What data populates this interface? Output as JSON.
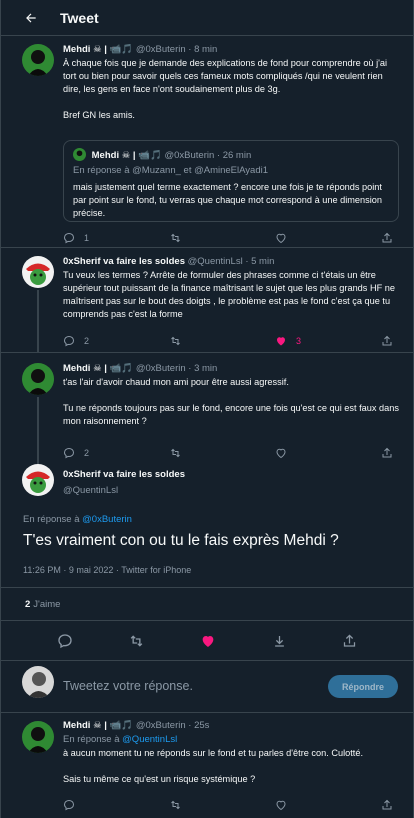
{
  "header": {
    "title": "Tweet"
  },
  "tweets": [
    {
      "name": "Mehdi ☠ | 📹🎵",
      "handle": "@0xButerin",
      "time": "· 8 min",
      "text": [
        "À chaque fois que je demande des explications de fond pour comprendre où j'ai tort ou bien pour savoir quels ces fameux mots compliqués /qui ne veulent rien dire, les gens en face n'ont soudainement plus de 3g.",
        "Bref GN les amis."
      ],
      "actions": {
        "reply": "1",
        "retweet": "",
        "like": "",
        "share": ""
      }
    },
    {
      "quote": {
        "name": "Mehdi ☠ | 📹🎵",
        "handle": "@0xButerin",
        "time": "· 26 min",
        "in_reply_prefix": "En réponse à",
        "in_reply_1": "@Muzann_",
        "in_reply_sep": "et",
        "in_reply_2": "@AmineElAyadi1",
        "text": "mais justement quel terme exactement ? encore une fois je te réponds point par point sur le fond, tu verras que chaque mot correspond à une dimension précise."
      }
    },
    {
      "name": "0xSherif va faire les soldes",
      "handle": "@QuentinLsl",
      "time": "· 5 min",
      "text": [
        "Tu veux les termes ? Arrête de formuler des phrases comme ci t'étais un être supérieur tout puissant de la finance maîtrisant le sujet que les plus grands HF ne maîtrisent pas sur le bout des doigts , le problème est pas le fond c'est ça que tu comprends pas c'est la forme"
      ],
      "actions": {
        "reply": "2",
        "retweet": "",
        "like": "3",
        "share": ""
      }
    },
    {
      "name": "Mehdi ☠ | 📹🎵",
      "handle": "@0xButerin",
      "time": "· 3 min",
      "text": [
        "t'as l'air d'avoir chaud mon ami pour être aussi agressif.",
        "Tu ne réponds toujours pas sur le fond, encore une fois qu'est ce qui est faux dans mon raisonnement ?"
      ],
      "actions": {
        "reply": "2",
        "retweet": "",
        "like": "",
        "share": ""
      }
    }
  ],
  "main": {
    "name": "0xSherif va faire les soldes",
    "handle": "@QuentinLsl",
    "in_reply_prefix": "En réponse à",
    "in_reply_to": "@0xButerin",
    "text": "T'es vraiment con ou tu le fais exprès Mehdi ?",
    "timestamp": "11:26 PM · 9 mai 2022 · Twitter for iPhone",
    "likes_count": "2",
    "likes_label": "J'aime"
  },
  "composer": {
    "placeholder": "Tweetez votre réponse.",
    "button": "Répondre"
  },
  "last_reply": {
    "name": "Mehdi ☠ | 📹🎵",
    "handle": "@0xButerin",
    "time": "· 25s",
    "in_reply_prefix": "En réponse à",
    "in_reply_to": "@QuentinLsl",
    "text": [
      "à aucun moment tu ne réponds sur le fond et tu parles d'être con. Culotté.",
      "Sais tu même ce qu'est un risque systémique ?"
    ]
  },
  "colors": {
    "background": "#15202b",
    "accent": "#1d9bf0",
    "like": "#f91880",
    "border": "#38444d",
    "muted": "#8b98a5"
  }
}
